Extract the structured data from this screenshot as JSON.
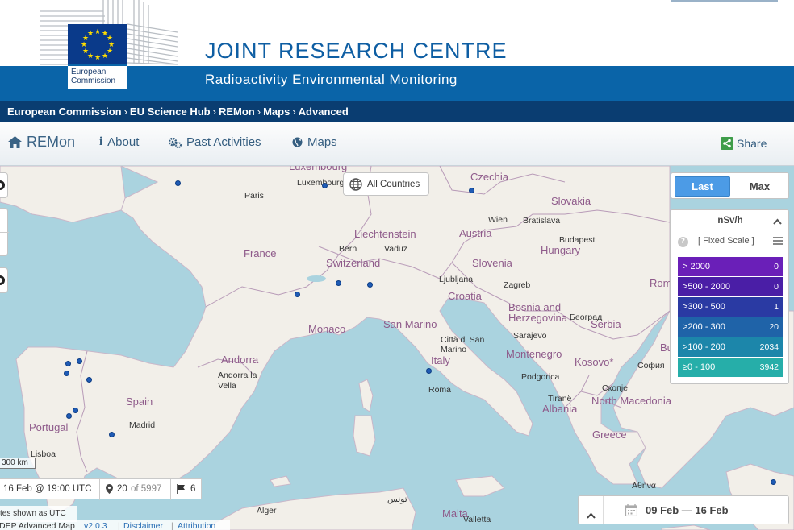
{
  "header": {
    "title": "JOINT RESEARCH CENTRE",
    "subtitle": "Radioactivity Environmental Monitoring",
    "logo_text_line1": "European",
    "logo_text_line2": "Commission"
  },
  "breadcrumb": [
    "European Commission",
    "EU Science Hub",
    "REMon",
    "Maps",
    "Advanced"
  ],
  "nav": {
    "home_label": "REMon",
    "about_label": "About",
    "past_label": "Past Activities",
    "maps_label": "Maps",
    "share_label": "Share"
  },
  "map": {
    "all_countries_label": "All Countries",
    "toggle": {
      "last": "Last",
      "max": "Max",
      "selected": "Last"
    },
    "legend": {
      "unit": "nSv/h",
      "scale_label": "[ Fixed Scale ]",
      "rows": [
        {
          "range": "> 2000",
          "count": "0",
          "color": "#6a1fb8"
        },
        {
          "range": ">500 - 2000",
          "count": "0",
          "color": "#4a1ea6"
        },
        {
          "range": ">300 - 500",
          "count": "1",
          "color": "#2a3aa3"
        },
        {
          "range": ">200 - 300",
          "count": "20",
          "color": "#1f63a8"
        },
        {
          "range": ">100 - 200",
          "count": "2034",
          "color": "#1c86aa"
        },
        {
          "range": "≥0 - 100",
          "count": "3942",
          "color": "#26aea9"
        }
      ]
    },
    "countries": [
      "Luxembourg",
      "Czechia",
      "Slovakia",
      "France",
      "Liechtenstein",
      "Austria",
      "Hungary",
      "Switzerland",
      "Slovenia",
      "Croatia",
      "Bosnia and Herzegovina",
      "Serbia",
      "Monaco",
      "San Marino",
      "Italy",
      "Montenegro",
      "Kosovo*",
      "Andorra",
      "Spain",
      "Portugal",
      "Albania",
      "North Macedonia",
      "Greece",
      "Malta",
      "Rom",
      "Bu"
    ],
    "cities": [
      "Paris",
      "Luxembourg",
      "Wien",
      "Bratislava",
      "Budapest",
      "Bern",
      "Vaduz",
      "Ljubljana",
      "Zagreb",
      "Sarajevo",
      "Београд",
      "Città di San Marino",
      "Roma",
      "Andorra la Vella",
      "Madrid",
      "Lisboa",
      "Podgorica",
      "Tiranë",
      "Скопје",
      "София",
      "Αθήνα",
      "Alger",
      "تونس",
      "Valletta"
    ],
    "scale_label": "300 km",
    "timestamp": "16 Feb @ 19:00 UTC",
    "stations_shown": "20",
    "stations_of": "of 5997",
    "flag_count": "6",
    "utc_note": "tes shown as UTC",
    "attribution": {
      "name": "DEP Advanced Map",
      "version": "v2.0.3",
      "disclaimer": "Disclaimer",
      "attribution": "Attribution"
    },
    "date_range": "09 Feb — 16 Feb"
  }
}
